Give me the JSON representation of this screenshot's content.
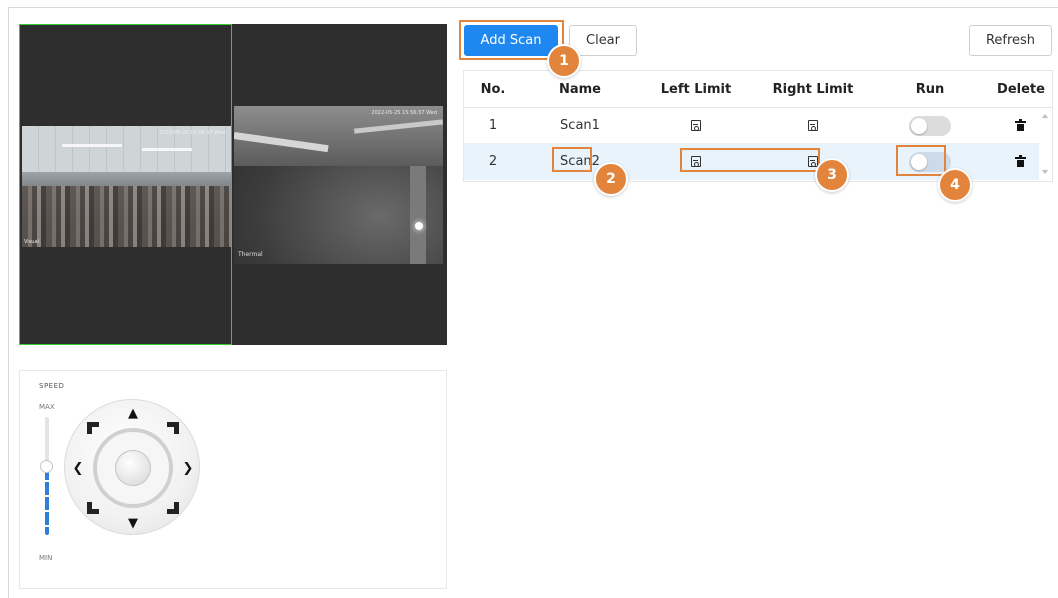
{
  "toolbar": {
    "add_scan": "Add Scan",
    "clear": "Clear",
    "refresh": "Refresh"
  },
  "table": {
    "headers": {
      "no": "No.",
      "name": "Name",
      "left_limit": "Left Limit",
      "right_limit": "Right Limit",
      "run": "Run",
      "delete": "Delete"
    },
    "rows": [
      {
        "no": "1",
        "name": "Scan1",
        "run": false
      },
      {
        "no": "2",
        "name": "Scan2",
        "run": false
      }
    ]
  },
  "ptz": {
    "speed_label": "SPEED",
    "max_label": "MAX",
    "min_label": "MIN",
    "speed_level": 0.58
  },
  "video": {
    "visible_timestamp": "2022-05-25 15:56:37 Wed",
    "thermal_timestamp": "2022-05-25 15:56:37 Wed",
    "visible_channel_label": "Visual",
    "thermal_channel_label": "Thermal"
  },
  "callouts": [
    "1",
    "2",
    "3",
    "4"
  ],
  "colors": {
    "primary": "#1e88f0",
    "callout": "#e3843d",
    "selected_row": "#e9f3fc",
    "active_video_border": "#33cc33"
  },
  "icons": {
    "left_limit": "save-icon",
    "right_limit": "save-icon",
    "delete": "trash-icon"
  }
}
